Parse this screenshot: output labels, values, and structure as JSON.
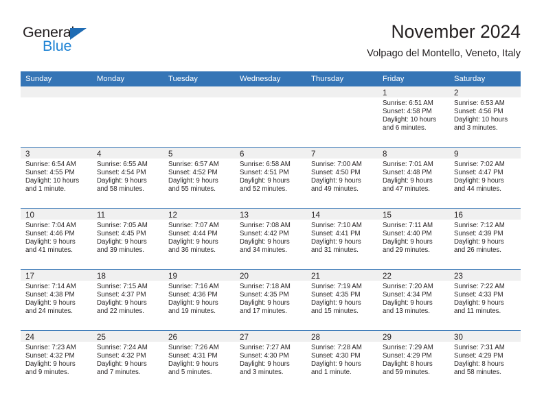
{
  "brand": {
    "name_top": "General",
    "name_bottom": "Blue",
    "accent_color": "#1f83d4",
    "triangle_color": "#1f6cb4"
  },
  "header": {
    "title": "November 2024",
    "subtitle": "Volpago del Montello, Veneto, Italy",
    "header_bar_color": "#3575b6",
    "daynum_band_color": "#f0f0f0"
  },
  "weekdays": [
    "Sunday",
    "Monday",
    "Tuesday",
    "Wednesday",
    "Thursday",
    "Friday",
    "Saturday"
  ],
  "weeks": [
    [
      {
        "empty": true
      },
      {
        "empty": true
      },
      {
        "empty": true
      },
      {
        "empty": true
      },
      {
        "empty": true
      },
      {
        "day": "1",
        "sunrise": "Sunrise: 6:51 AM",
        "sunset": "Sunset: 4:58 PM",
        "daylight1": "Daylight: 10 hours",
        "daylight2": "and 6 minutes."
      },
      {
        "day": "2",
        "sunrise": "Sunrise: 6:53 AM",
        "sunset": "Sunset: 4:56 PM",
        "daylight1": "Daylight: 10 hours",
        "daylight2": "and 3 minutes."
      }
    ],
    [
      {
        "day": "3",
        "sunrise": "Sunrise: 6:54 AM",
        "sunset": "Sunset: 4:55 PM",
        "daylight1": "Daylight: 10 hours",
        "daylight2": "and 1 minute."
      },
      {
        "day": "4",
        "sunrise": "Sunrise: 6:55 AM",
        "sunset": "Sunset: 4:54 PM",
        "daylight1": "Daylight: 9 hours",
        "daylight2": "and 58 minutes."
      },
      {
        "day": "5",
        "sunrise": "Sunrise: 6:57 AM",
        "sunset": "Sunset: 4:52 PM",
        "daylight1": "Daylight: 9 hours",
        "daylight2": "and 55 minutes."
      },
      {
        "day": "6",
        "sunrise": "Sunrise: 6:58 AM",
        "sunset": "Sunset: 4:51 PM",
        "daylight1": "Daylight: 9 hours",
        "daylight2": "and 52 minutes."
      },
      {
        "day": "7",
        "sunrise": "Sunrise: 7:00 AM",
        "sunset": "Sunset: 4:50 PM",
        "daylight1": "Daylight: 9 hours",
        "daylight2": "and 49 minutes."
      },
      {
        "day": "8",
        "sunrise": "Sunrise: 7:01 AM",
        "sunset": "Sunset: 4:48 PM",
        "daylight1": "Daylight: 9 hours",
        "daylight2": "and 47 minutes."
      },
      {
        "day": "9",
        "sunrise": "Sunrise: 7:02 AM",
        "sunset": "Sunset: 4:47 PM",
        "daylight1": "Daylight: 9 hours",
        "daylight2": "and 44 minutes."
      }
    ],
    [
      {
        "day": "10",
        "sunrise": "Sunrise: 7:04 AM",
        "sunset": "Sunset: 4:46 PM",
        "daylight1": "Daylight: 9 hours",
        "daylight2": "and 41 minutes."
      },
      {
        "day": "11",
        "sunrise": "Sunrise: 7:05 AM",
        "sunset": "Sunset: 4:45 PM",
        "daylight1": "Daylight: 9 hours",
        "daylight2": "and 39 minutes."
      },
      {
        "day": "12",
        "sunrise": "Sunrise: 7:07 AM",
        "sunset": "Sunset: 4:44 PM",
        "daylight1": "Daylight: 9 hours",
        "daylight2": "and 36 minutes."
      },
      {
        "day": "13",
        "sunrise": "Sunrise: 7:08 AM",
        "sunset": "Sunset: 4:42 PM",
        "daylight1": "Daylight: 9 hours",
        "daylight2": "and 34 minutes."
      },
      {
        "day": "14",
        "sunrise": "Sunrise: 7:10 AM",
        "sunset": "Sunset: 4:41 PM",
        "daylight1": "Daylight: 9 hours",
        "daylight2": "and 31 minutes."
      },
      {
        "day": "15",
        "sunrise": "Sunrise: 7:11 AM",
        "sunset": "Sunset: 4:40 PM",
        "daylight1": "Daylight: 9 hours",
        "daylight2": "and 29 minutes."
      },
      {
        "day": "16",
        "sunrise": "Sunrise: 7:12 AM",
        "sunset": "Sunset: 4:39 PM",
        "daylight1": "Daylight: 9 hours",
        "daylight2": "and 26 minutes."
      }
    ],
    [
      {
        "day": "17",
        "sunrise": "Sunrise: 7:14 AM",
        "sunset": "Sunset: 4:38 PM",
        "daylight1": "Daylight: 9 hours",
        "daylight2": "and 24 minutes."
      },
      {
        "day": "18",
        "sunrise": "Sunrise: 7:15 AM",
        "sunset": "Sunset: 4:37 PM",
        "daylight1": "Daylight: 9 hours",
        "daylight2": "and 22 minutes."
      },
      {
        "day": "19",
        "sunrise": "Sunrise: 7:16 AM",
        "sunset": "Sunset: 4:36 PM",
        "daylight1": "Daylight: 9 hours",
        "daylight2": "and 19 minutes."
      },
      {
        "day": "20",
        "sunrise": "Sunrise: 7:18 AM",
        "sunset": "Sunset: 4:35 PM",
        "daylight1": "Daylight: 9 hours",
        "daylight2": "and 17 minutes."
      },
      {
        "day": "21",
        "sunrise": "Sunrise: 7:19 AM",
        "sunset": "Sunset: 4:35 PM",
        "daylight1": "Daylight: 9 hours",
        "daylight2": "and 15 minutes."
      },
      {
        "day": "22",
        "sunrise": "Sunrise: 7:20 AM",
        "sunset": "Sunset: 4:34 PM",
        "daylight1": "Daylight: 9 hours",
        "daylight2": "and 13 minutes."
      },
      {
        "day": "23",
        "sunrise": "Sunrise: 7:22 AM",
        "sunset": "Sunset: 4:33 PM",
        "daylight1": "Daylight: 9 hours",
        "daylight2": "and 11 minutes."
      }
    ],
    [
      {
        "day": "24",
        "sunrise": "Sunrise: 7:23 AM",
        "sunset": "Sunset: 4:32 PM",
        "daylight1": "Daylight: 9 hours",
        "daylight2": "and 9 minutes."
      },
      {
        "day": "25",
        "sunrise": "Sunrise: 7:24 AM",
        "sunset": "Sunset: 4:32 PM",
        "daylight1": "Daylight: 9 hours",
        "daylight2": "and 7 minutes."
      },
      {
        "day": "26",
        "sunrise": "Sunrise: 7:26 AM",
        "sunset": "Sunset: 4:31 PM",
        "daylight1": "Daylight: 9 hours",
        "daylight2": "and 5 minutes."
      },
      {
        "day": "27",
        "sunrise": "Sunrise: 7:27 AM",
        "sunset": "Sunset: 4:30 PM",
        "daylight1": "Daylight: 9 hours",
        "daylight2": "and 3 minutes."
      },
      {
        "day": "28",
        "sunrise": "Sunrise: 7:28 AM",
        "sunset": "Sunset: 4:30 PM",
        "daylight1": "Daylight: 9 hours",
        "daylight2": "and 1 minute."
      },
      {
        "day": "29",
        "sunrise": "Sunrise: 7:29 AM",
        "sunset": "Sunset: 4:29 PM",
        "daylight1": "Daylight: 8 hours",
        "daylight2": "and 59 minutes."
      },
      {
        "day": "30",
        "sunrise": "Sunrise: 7:31 AM",
        "sunset": "Sunset: 4:29 PM",
        "daylight1": "Daylight: 8 hours",
        "daylight2": "and 58 minutes."
      }
    ]
  ]
}
